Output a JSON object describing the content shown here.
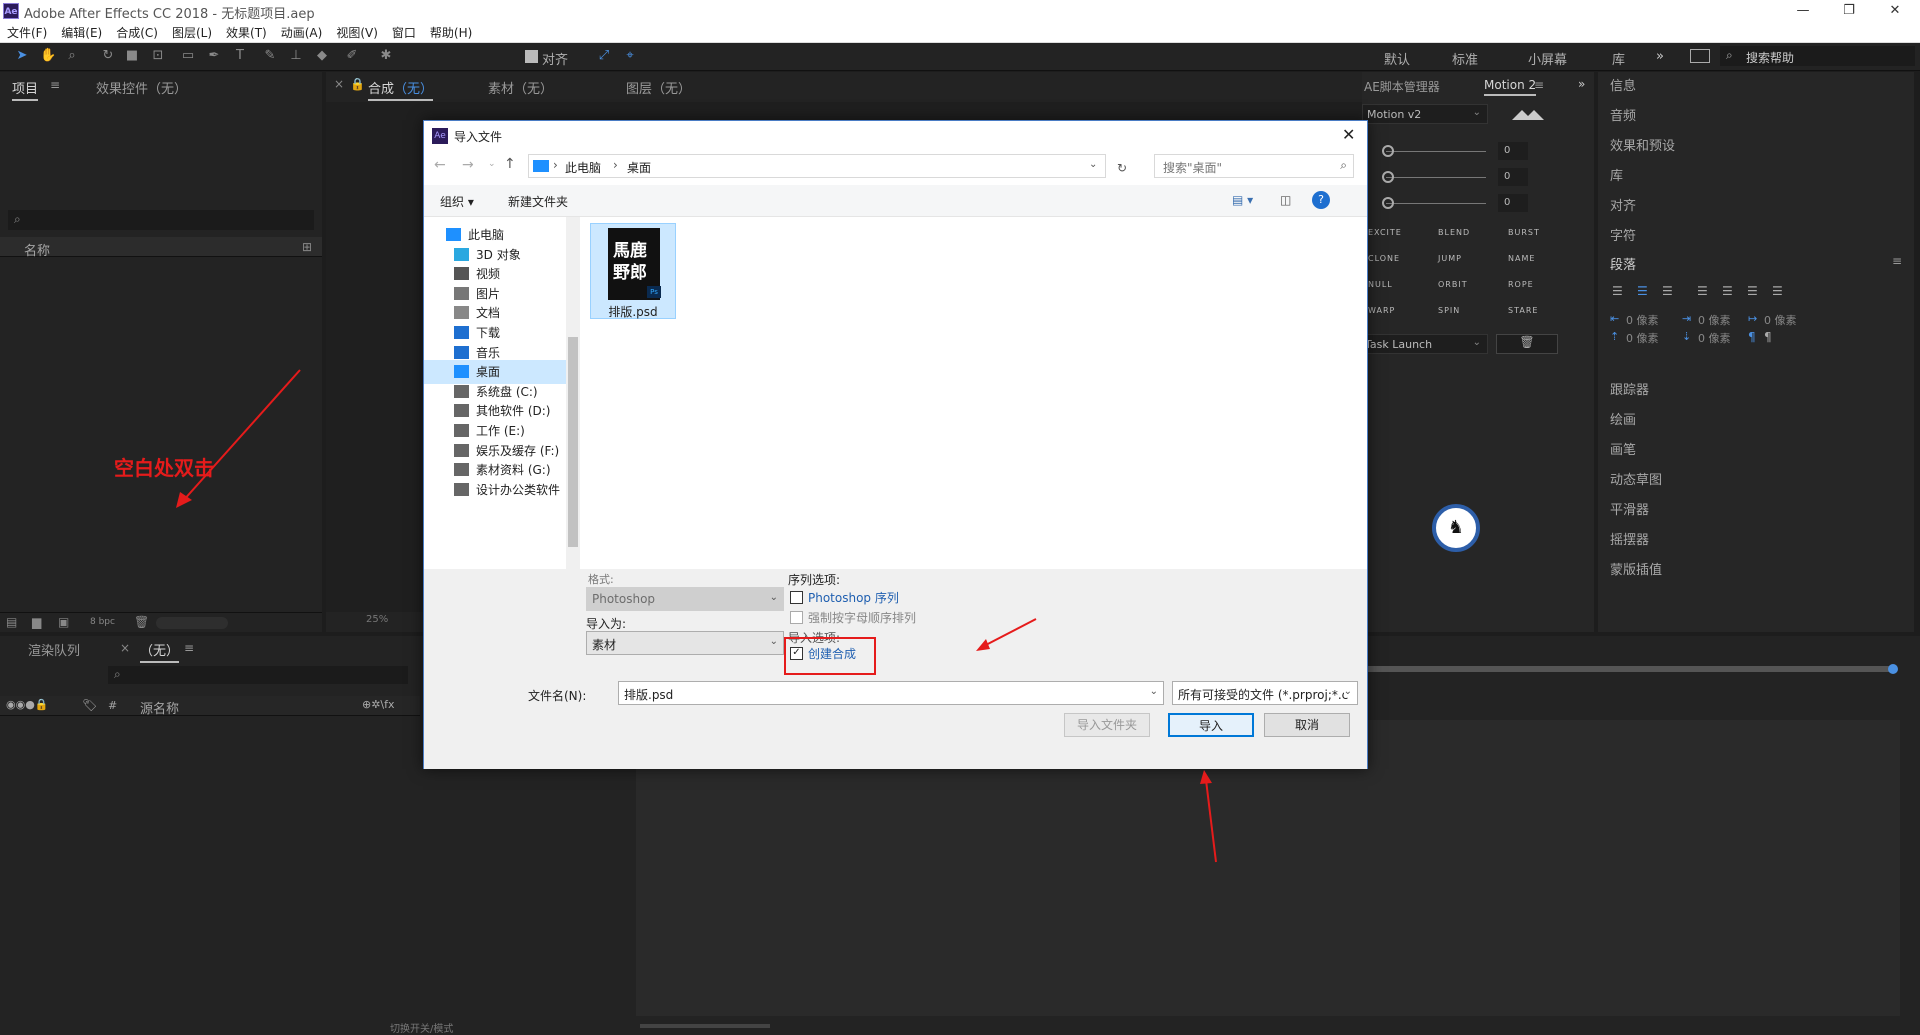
{
  "app": {
    "title": "Adobe After Effects CC 2018 - 无标题项目.aep",
    "logo": "Ae"
  },
  "menu": [
    "文件(F)",
    "编辑(E)",
    "合成(C)",
    "图层(L)",
    "效果(T)",
    "动画(A)",
    "视图(V)",
    "窗口",
    "帮助(H)"
  ],
  "toolbar": {
    "align_label": "对齐",
    "workspaces": [
      "默认",
      "标准",
      "小屏幕",
      "库"
    ],
    "search_help": "搜索帮助"
  },
  "project_panel": {
    "tab_project": "项目",
    "tab_effects": "效果控件（无）",
    "column_name": "名称",
    "bpc": "8 bpc"
  },
  "comp_panel": {
    "tab_comp": "合成",
    "tab_comp_value": "（无）",
    "tab_footage": "素材（无）",
    "tab_layer": "图层（无）",
    "zoom": "25%"
  },
  "timeline": {
    "tab_render": "渲染队列",
    "tab_none": "（无）",
    "col_hash": "#",
    "col_source": "源名称",
    "bottom_toggle": "切换开关/模式"
  },
  "script_panel": {
    "title": "AE脚本管理器",
    "tab_motion": "Motion 2",
    "preset": "Motion v2",
    "values": [
      "0",
      "0",
      "0"
    ],
    "actions": [
      "EXCITE",
      "BLEND",
      "BURST",
      "CLONE",
      "JUMP",
      "NAME",
      "NULL",
      "ORBIT",
      "ROPE",
      "WARP",
      "SPIN",
      "STARE"
    ],
    "task_launch": "Task Launch"
  },
  "right_panel": {
    "items_top": [
      "信息",
      "音频",
      "效果和预设",
      "库",
      "对齐",
      "字符"
    ],
    "paragraph": "段落",
    "px": "0 像素",
    "items_bottom": [
      "跟踪器",
      "绘画",
      "画笔",
      "动态草图",
      "平滑器",
      "摇摆器",
      "蒙版插值"
    ]
  },
  "dialog": {
    "title": "导入文件",
    "path": [
      "此电脑",
      "桌面"
    ],
    "search_placeholder": "搜索\"桌面\"",
    "organize": "组织 ▾",
    "new_folder": "新建文件夹",
    "tree": [
      {
        "label": "此电脑",
        "icon": "pc-icon"
      },
      {
        "label": "3D 对象",
        "icon": "3d-objects-icon"
      },
      {
        "label": "视频",
        "icon": "video-icon"
      },
      {
        "label": "图片",
        "icon": "pictures-icon"
      },
      {
        "label": "文档",
        "icon": "documents-icon"
      },
      {
        "label": "下载",
        "icon": "download-icon"
      },
      {
        "label": "音乐",
        "icon": "music-icon"
      },
      {
        "label": "桌面",
        "icon": "desktop-icon"
      },
      {
        "label": "系统盘 (C:)",
        "icon": "drive-icon"
      },
      {
        "label": "其他软件 (D:)",
        "icon": "drive-icon"
      },
      {
        "label": "工作 (E:)",
        "icon": "drive-icon"
      },
      {
        "label": "娱乐及缓存 (F:)",
        "icon": "drive-icon"
      },
      {
        "label": "素材资料 (G:)",
        "icon": "drive-icon"
      },
      {
        "label": "设计办公类软件",
        "icon": "drive-icon"
      }
    ],
    "file": {
      "name": "排版.psd",
      "thumb_text": "馬鹿\n野郎",
      "badge": "Ps"
    },
    "format_label": "格式:",
    "format_value": "Photoshop",
    "import_as_label": "导入为:",
    "import_as_value": "素材",
    "sequence_label": "序列选项:",
    "sequence_option": "Photoshop 序列",
    "force_alpha": "强制按字母顺序排列",
    "import_options_label": "导入选项:",
    "create_comp": "创建合成",
    "filename_label": "文件名(N):",
    "filename_value": "排版.psd",
    "filetype": "所有可接受的文件 (*.prproj;*.c",
    "btn_import_folder": "导入文件夹",
    "btn_import": "导入",
    "btn_cancel": "取消"
  },
  "annotation": {
    "text": "空白处双击"
  },
  "colors": {
    "accent_blue": "#2f6fb8",
    "annotation_red": "#e51b1b",
    "ae_purple": "#2b1b5a"
  }
}
